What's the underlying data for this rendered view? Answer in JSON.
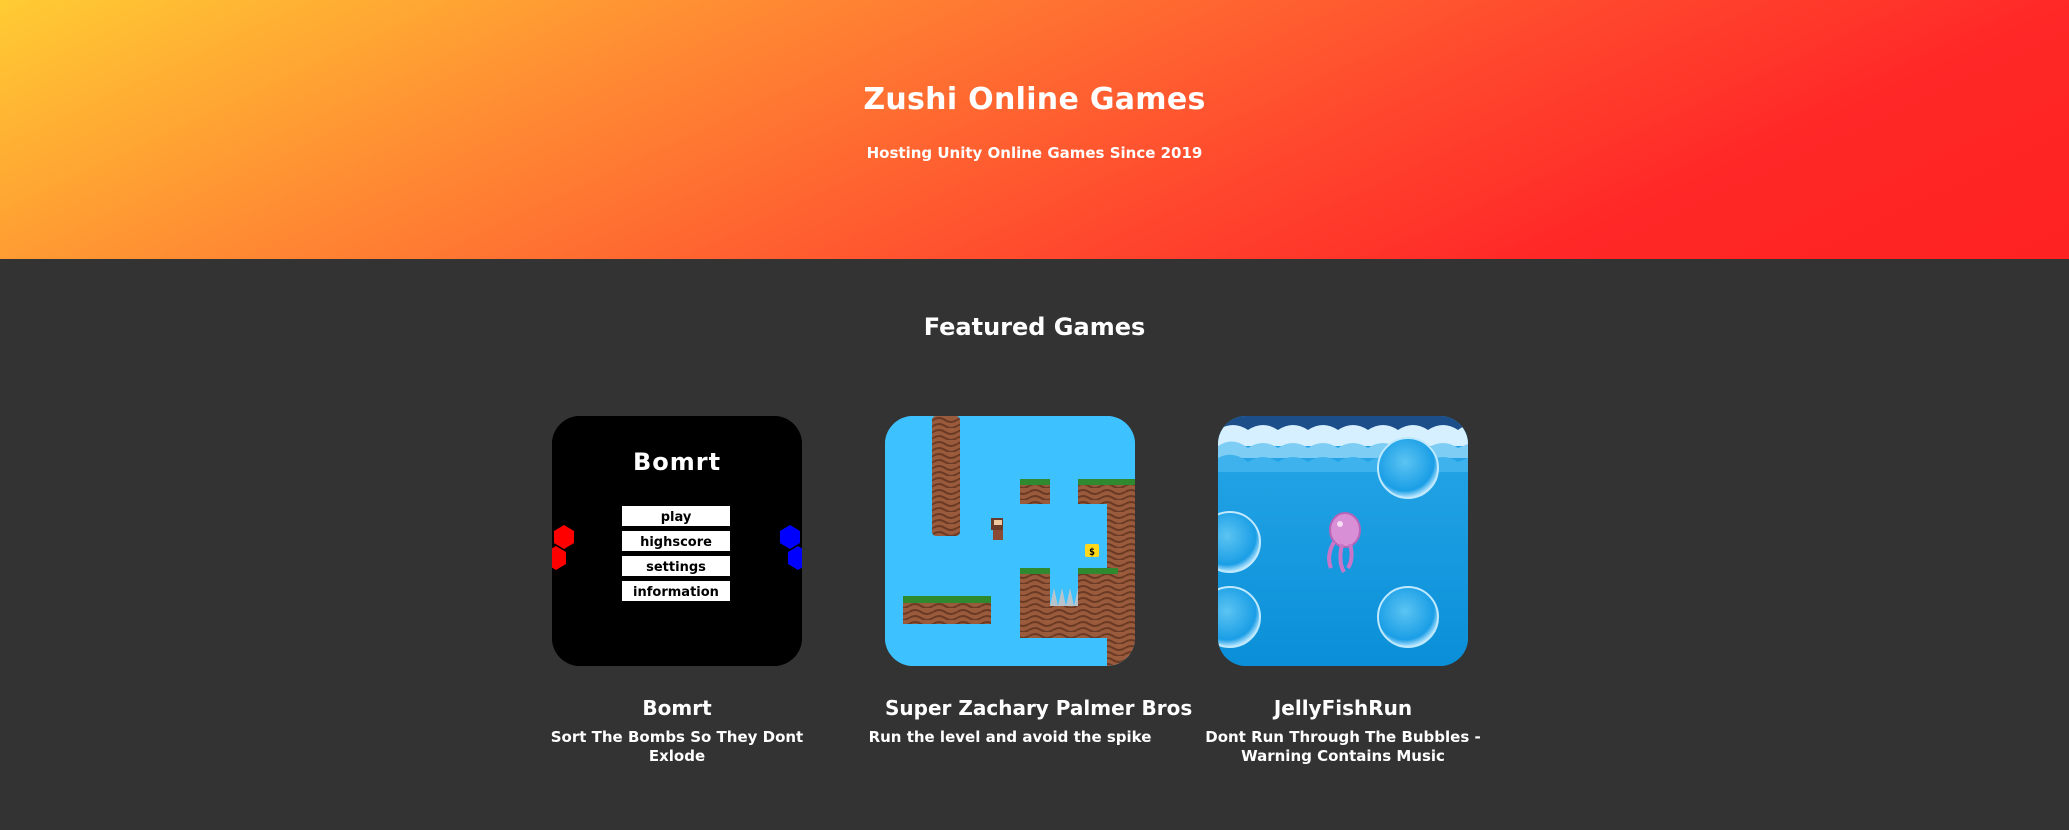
{
  "hero": {
    "title": "Zushi Online Games",
    "subtitle": "Hosting Unity Online Games Since 2019"
  },
  "featured": {
    "title": "Featured Games",
    "games": [
      {
        "name": "Bomrt",
        "description": "Sort The Bombs So They Dont Exlode",
        "thumbnail": {
          "logo": "Bomrt",
          "menu": [
            "play",
            "highscore",
            "settings",
            "information"
          ]
        }
      },
      {
        "name": "Super Zachary Palmer Bros",
        "description": "Run the level and avoid the spike",
        "thumbnail": {
          "coin_label": "$"
        }
      },
      {
        "name": "JellyFishRun",
        "description": "Dont Run Through The Bubbles - Warning Contains Music"
      }
    ]
  },
  "colors": {
    "hero_gradient_start": "#ffcc33",
    "hero_gradient_end": "#ff2222",
    "page_background": "#333333",
    "text": "#ffffff"
  }
}
